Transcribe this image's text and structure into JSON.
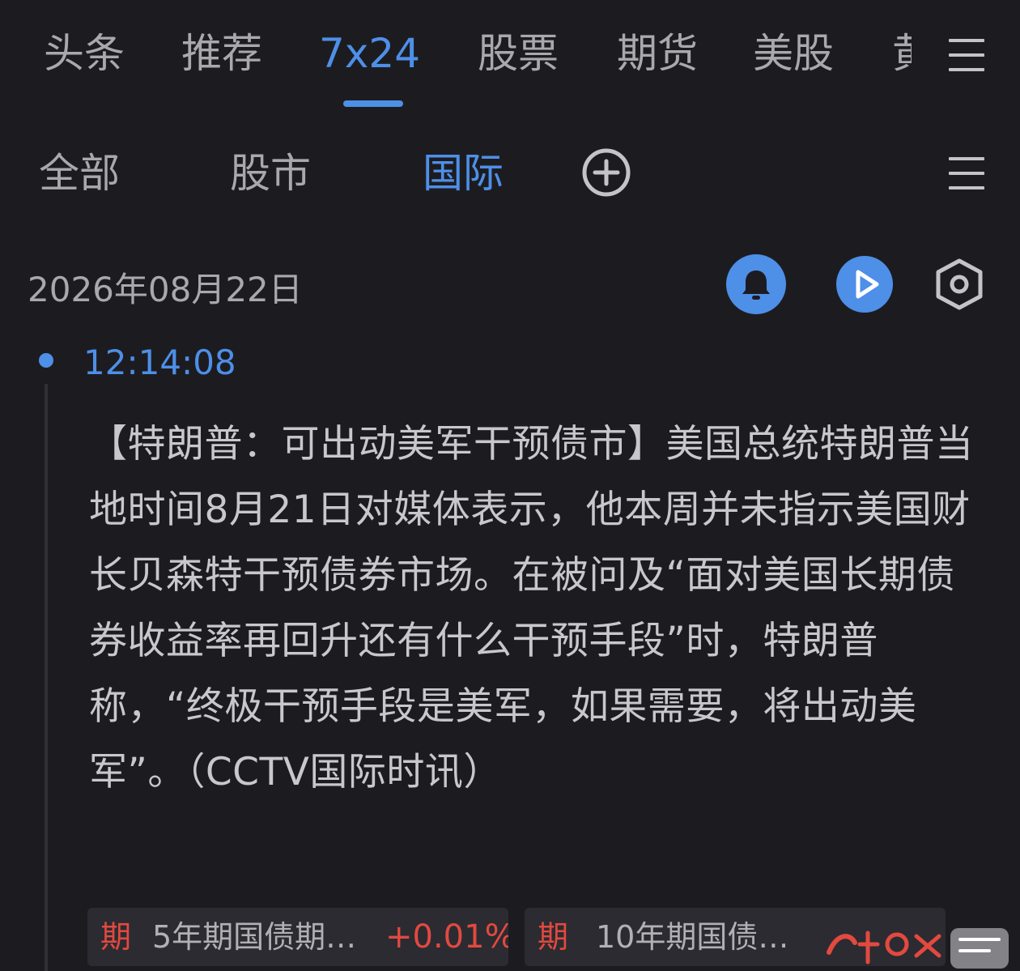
{
  "top_tabs": {
    "items": [
      {
        "label": "头条"
      },
      {
        "label": "推荐"
      },
      {
        "label": "7x24"
      },
      {
        "label": "股票"
      },
      {
        "label": "期货"
      },
      {
        "label": "美股"
      },
      {
        "label": "黄"
      }
    ],
    "active": "7x24"
  },
  "sub_tabs": {
    "items": [
      {
        "label": "全部"
      },
      {
        "label": "股市"
      },
      {
        "label": "国际"
      }
    ],
    "active": "国际"
  },
  "icons": {
    "top_menu": "menu-icon",
    "sub_menu": "menu-icon",
    "add": "plus-circle-icon",
    "bell": "bell-icon",
    "play": "play-icon",
    "settings": "settings-hexagon-icon"
  },
  "feed": {
    "date": "2026年08月22日",
    "items": [
      {
        "time": "12:14:08",
        "text": "【特朗普：可出动美军干预债市】美国总统特朗普当地时间8月21日对媒体表示，他本周并未指示美国财长贝森特干预债券市场。在被问及“面对美国长期债券收益率再回升还有什么干预手段”时，特朗普称，“终极干预手段是美军，如果需要，将出动美军”。（CCTV国际时讯）",
        "tags": [
          {
            "type": "期",
            "name": "5年期国债期…",
            "change": "+0.01%"
          },
          {
            "type": "期",
            "name": "10年期国债…",
            "change": ""
          }
        ]
      }
    ]
  },
  "colors": {
    "background": "#1c1c20",
    "accent": "#4e8fe8",
    "up": "#e2493f",
    "text": "#c8c8cc",
    "muted": "#a8a8ad"
  }
}
